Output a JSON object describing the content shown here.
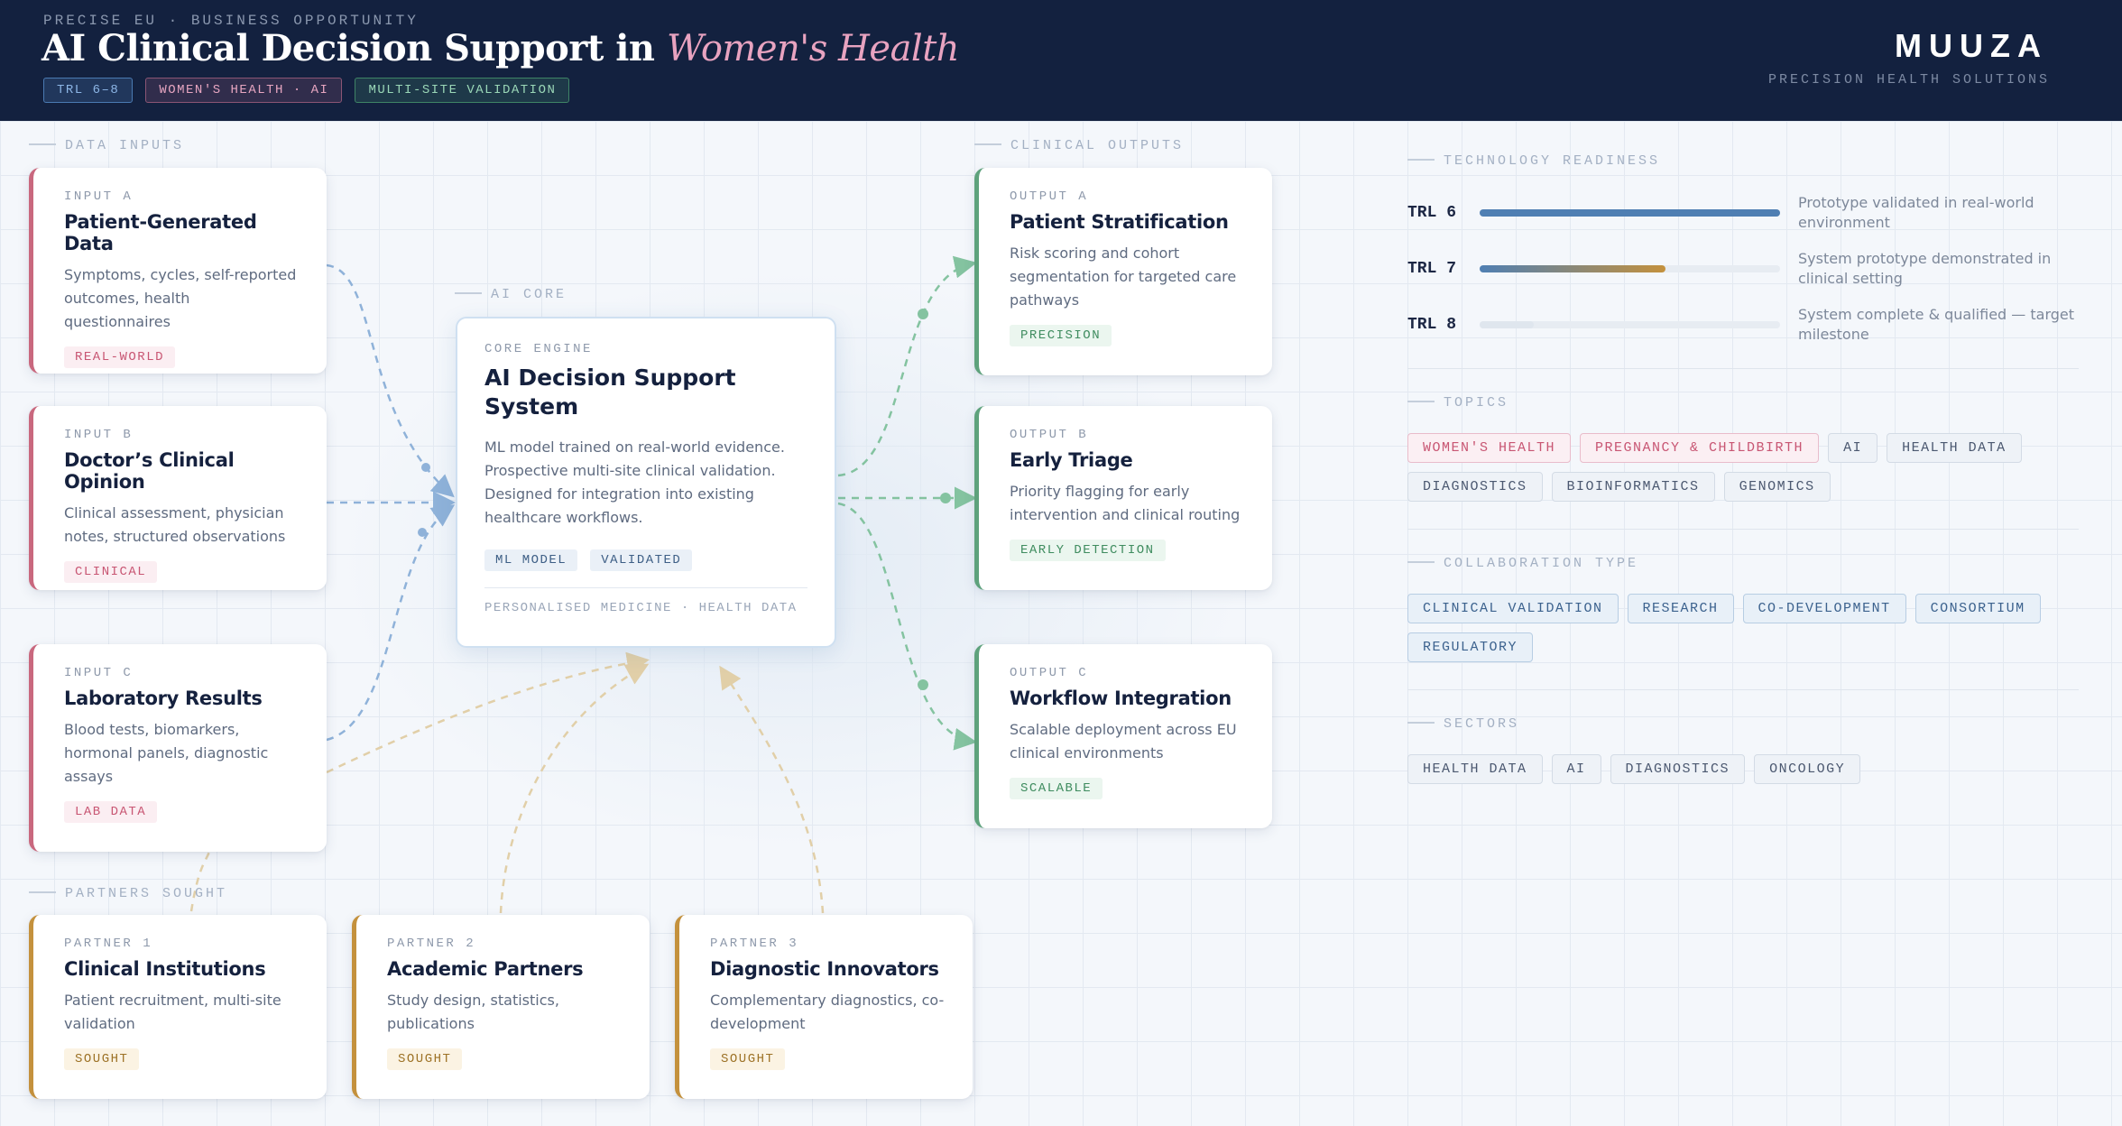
{
  "header": {
    "eyebrow": "PRECISE EU · BUSINESS OPPORTUNITY",
    "title_main": "AI Clinical Decision Support in ",
    "title_accent": "Women's Health",
    "badges": [
      "TRL 6–8",
      "WOMEN'S HEALTH · AI",
      "MULTI-SITE VALIDATION"
    ],
    "brand": "MUUZA",
    "brand_sub": "PRECISION HEALTH SOLUTIONS"
  },
  "sections": {
    "inputs": "DATA INPUTS",
    "core": "AI CORE",
    "outputs": "CLINICAL OUTPUTS",
    "partners": "PARTNERS SOUGHT"
  },
  "inputs": [
    {
      "kicker": "INPUT A",
      "title": "Patient-Generated Data",
      "desc": "Symptoms, cycles, self-reported outcomes, health questionnaires",
      "tag": "REAL-WORLD"
    },
    {
      "kicker": "INPUT B",
      "title": "Doctor’s Clinical Opinion",
      "desc": "Clinical assessment, physician notes, structured observations",
      "tag": "CLINICAL"
    },
    {
      "kicker": "INPUT C",
      "title": "Laboratory Results",
      "desc": "Blood tests, biomarkers, hormonal panels, diagnostic assays",
      "tag": "LAB DATA"
    }
  ],
  "core": {
    "kicker": "CORE ENGINE",
    "title": "AI Decision Support System",
    "desc": "ML model trained on real-world evidence. Prospective multi-site clinical validation. Designed for integration into existing healthcare workflows.",
    "tags": [
      "ML MODEL",
      "VALIDATED"
    ],
    "footer": "PERSONALISED MEDICINE · HEALTH DATA"
  },
  "outputs": [
    {
      "kicker": "OUTPUT A",
      "title": "Patient Stratification",
      "desc": "Risk scoring and cohort segmentation for targeted care pathways",
      "tag": "PRECISION"
    },
    {
      "kicker": "OUTPUT B",
      "title": "Early Triage",
      "desc": "Priority flagging for early intervention and clinical routing",
      "tag": "EARLY DETECTION"
    },
    {
      "kicker": "OUTPUT C",
      "title": "Workflow Integration",
      "desc": "Scalable deployment across EU clinical environments",
      "tag": "SCALABLE"
    }
  ],
  "partners": [
    {
      "kicker": "PARTNER 1",
      "title": "Clinical Institutions",
      "desc": "Patient recruitment, multi-site validation",
      "tag": "SOUGHT"
    },
    {
      "kicker": "PARTNER 2",
      "title": "Academic Partners",
      "desc": "Study design, statistics, publications",
      "tag": "SOUGHT"
    },
    {
      "kicker": "PARTNER 3",
      "title": "Diagnostic Innovators",
      "desc": "Complementary diagnostics, co-development",
      "tag": "SOUGHT"
    }
  ],
  "panel": {
    "trl_label": "TECHNOLOGY READINESS",
    "trl": [
      {
        "level": "TRL 6",
        "progress": 1.0,
        "desc": "Prototype validated in real-world environment"
      },
      {
        "level": "TRL 7",
        "progress": 0.62,
        "desc": "System prototype demonstrated in clinical setting"
      },
      {
        "level": "TRL 8",
        "progress": 0.18,
        "desc": "System complete & qualified — target milestone"
      }
    ],
    "topics_label": "TOPICS",
    "topics": [
      "WOMEN'S HEALTH",
      "PREGNANCY & CHILDBIRTH",
      "AI",
      "HEALTH DATA",
      "DIAGNOSTICS",
      "BIOINFORMATICS",
      "GENOMICS"
    ],
    "collab_label": "COLLABORATION TYPE",
    "collab": [
      "CLINICAL VALIDATION",
      "RESEARCH",
      "CO-DEVELOPMENT",
      "CONSORTIUM",
      "REGULATORY"
    ],
    "sectors_label": "SECTORS",
    "sectors": [
      "HEALTH DATA",
      "AI",
      "DIAGNOSTICS",
      "ONCOLOGY"
    ]
  },
  "colors": {
    "header_bg": "#13213f",
    "input_accent": "#c9687e",
    "output_accent": "#5ea27c",
    "partner_accent": "#c4913d",
    "trl_fill_6": "#4f7fb3",
    "trl_fill_7_gradient": [
      "#4f7fb3",
      "#c4913d"
    ],
    "flow_input": "#8fb2d9",
    "flow_output": "#84c3a0",
    "flow_partner": "#e1cfa8"
  }
}
